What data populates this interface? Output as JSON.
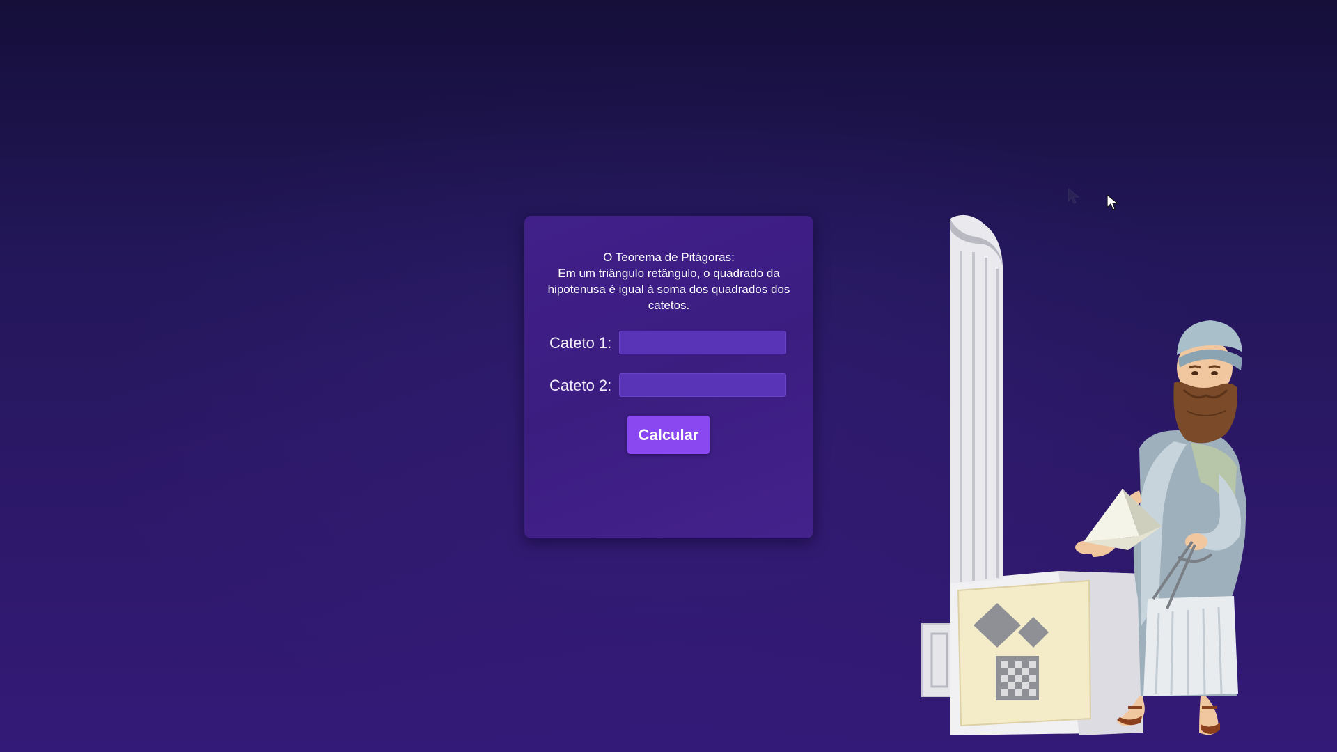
{
  "card": {
    "theorem_title": "O Teorema de Pitágoras:",
    "theorem_text": "Em um triângulo retângulo, o quadrado da hipotenusa é igual à soma dos quadrados dos catetos.",
    "fields": [
      {
        "label": "Cateto 1:",
        "value": "",
        "placeholder": ""
      },
      {
        "label": "Cateto 2:",
        "value": "",
        "placeholder": ""
      }
    ],
    "button_label": "Calcular"
  },
  "illustration": {
    "subject": "pythagoras-icon"
  },
  "colors": {
    "background_top": "#150f3a",
    "background_bottom": "#341a78",
    "card": "#3e1f86",
    "input": "#5a34b6",
    "button": "#8a48f0",
    "text": "#ffffff"
  },
  "icons": [
    "pythagoras-icon",
    "column-icon",
    "pyramid-icon",
    "compass-icon",
    "pedestal-icon",
    "cursor-icon"
  ]
}
